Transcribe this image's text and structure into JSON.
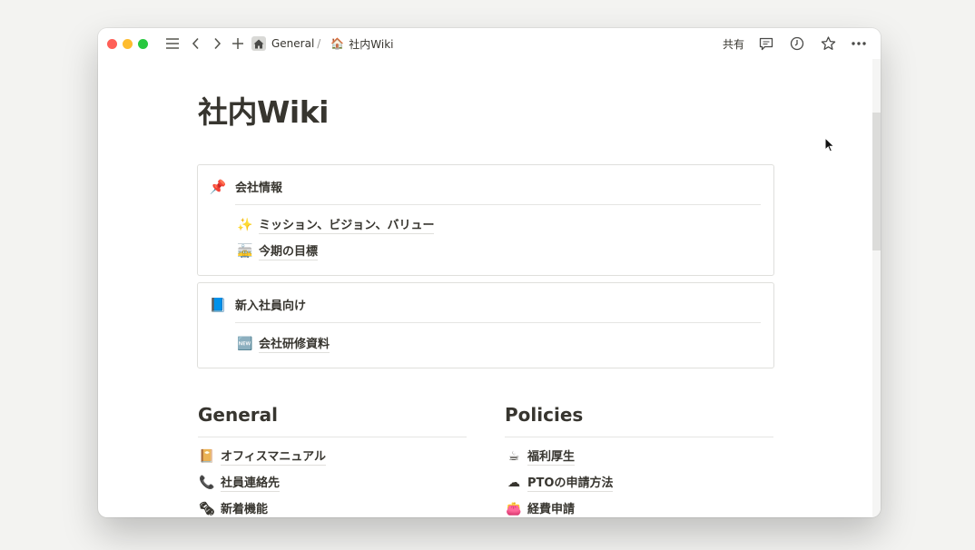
{
  "breadcrumb": {
    "home_label": "General",
    "separator": "/",
    "page_emoji": "🏠",
    "page_label": "社内Wiki"
  },
  "toolbar": {
    "share_label": "共有"
  },
  "page": {
    "title": "社内Wiki"
  },
  "cards": [
    {
      "emoji": "📌",
      "heading": "会社情報",
      "links": [
        {
          "emoji": "✨",
          "label": "ミッション、ビジョン、バリュー"
        },
        {
          "emoji": "🚋",
          "label": "今期の目標"
        }
      ]
    },
    {
      "emoji": "📘",
      "heading": "新入社員向け",
      "links": [
        {
          "emoji": "🆕",
          "label": "会社研修資料"
        }
      ]
    }
  ],
  "sections": [
    {
      "title": "General",
      "items": [
        {
          "emoji": "📔",
          "label": "オフィスマニュアル"
        },
        {
          "emoji": "📞",
          "label": "社員連絡先"
        },
        {
          "emoji": "🗞",
          "label": "新着機能"
        }
      ]
    },
    {
      "title": "Policies",
      "items": [
        {
          "emoji": "☕",
          "label": "福利厚生"
        },
        {
          "emoji": "☁",
          "label": "PTOの申請方法"
        },
        {
          "emoji": "👛",
          "label": "経費申請"
        }
      ]
    }
  ],
  "colors": {
    "text": "#37352f",
    "rule": "#e5e5e3",
    "window_bg": "#ffffff",
    "desktop_bg": "#f3f3f1"
  }
}
